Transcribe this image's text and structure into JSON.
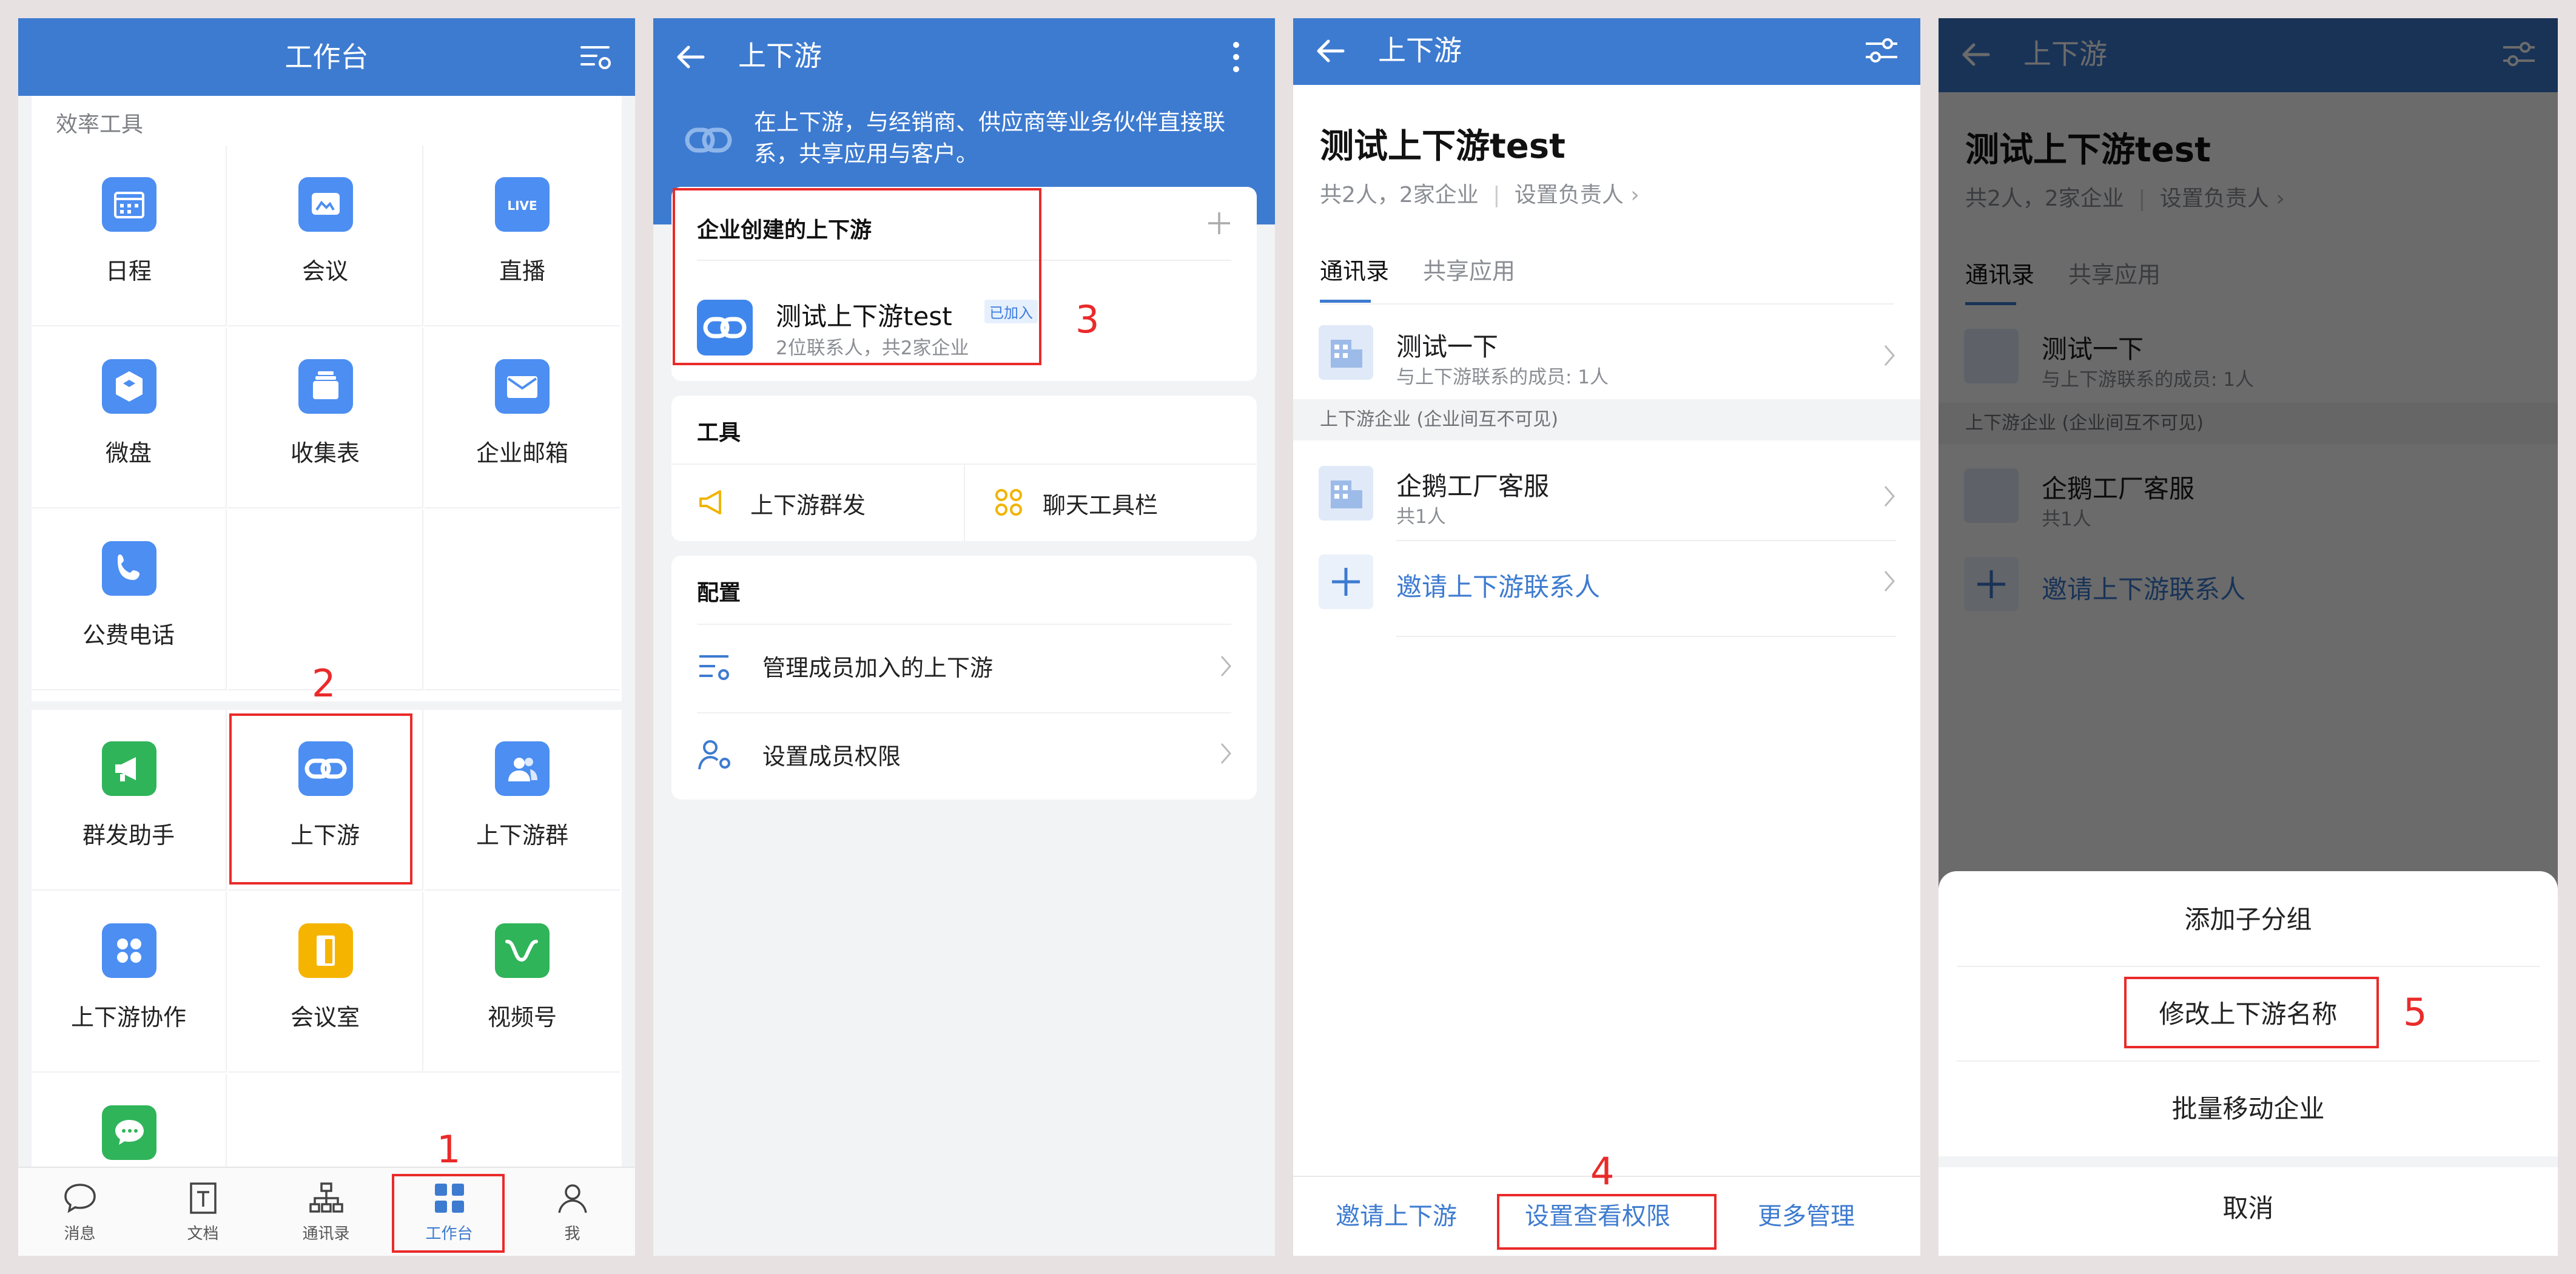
{
  "colors": {
    "brand_blue": "#3d7bd0",
    "annotation_red": "#ea2a2a"
  },
  "p1": {
    "title": "工作台",
    "section_label": "效率工具",
    "apps_top": [
      {
        "label": "日程",
        "icon": "calendar-icon",
        "color": "#4c8ef2"
      },
      {
        "label": "会议",
        "icon": "meeting-icon",
        "color": "#4c8ef2"
      },
      {
        "label": "直播",
        "icon": "live-icon",
        "color": "#4c8ef2",
        "badge": "LIVE"
      },
      {
        "label": "微盘",
        "icon": "drive-icon",
        "color": "#4c8ef2"
      },
      {
        "label": "收集表",
        "icon": "form-icon",
        "color": "#4c8ef2"
      },
      {
        "label": "企业邮箱",
        "icon": "mail-icon",
        "color": "#4c8ef2"
      },
      {
        "label": "公费电话",
        "icon": "phone-icon",
        "color": "#4c8ef2"
      }
    ],
    "apps_bottom": [
      {
        "label": "群发助手",
        "icon": "megaphone-icon",
        "color": "#2fb45a"
      },
      {
        "label": "上下游",
        "icon": "link-icon",
        "color": "#4c8ef2"
      },
      {
        "label": "上下游群",
        "icon": "group-icon",
        "color": "#4c8ef2"
      },
      {
        "label": "上下游协作",
        "icon": "collab-icon",
        "color": "#4c8ef2"
      },
      {
        "label": "会议室",
        "icon": "door-icon",
        "color": "#f5b400"
      },
      {
        "label": "视频号",
        "icon": "channels-icon",
        "color": "#2fb45a"
      }
    ],
    "tabs": [
      "消息",
      "文档",
      "通讯录",
      "工作台",
      "我"
    ],
    "annotations": [
      "1",
      "2"
    ]
  },
  "p2": {
    "title": "上下游",
    "banner": "在上下游，与经销商、供应商等业务伙伴直接联系，共享应用与客户。",
    "created_title": "企业创建的上下游",
    "item_name": "测试上下游test",
    "item_tag": "已加入",
    "item_sub": "2位联系人，共2家企业",
    "tools_title": "工具",
    "tool1": "上下游群发",
    "tool2": "聊天工具栏",
    "config_title": "配置",
    "config1": "管理成员加入的上下游",
    "config2": "设置成员权限",
    "annotation": "3"
  },
  "p3": {
    "title": "上下游",
    "name": "测试上下游test",
    "meta_count": "共2人，2家企业",
    "meta_link": "设置负责人",
    "tab1": "通讯录",
    "tab2": "共享应用",
    "entry1_title": "测试一下",
    "entry1_sub": "与上下游联系的成员: 1人",
    "band": "上下游企业 (企业间互不可见)",
    "entry2_title": "企鹅工厂客服",
    "entry2_sub": "共1人",
    "invite": "邀请上下游联系人",
    "btn1": "邀请上下游",
    "btn2": "设置查看权限",
    "btn3": "更多管理",
    "annotation": "4"
  },
  "p4": {
    "sheet1": "添加子分组",
    "sheet2": "修改上下游名称",
    "sheet3": "批量移动企业",
    "cancel": "取消",
    "annotation": "5"
  }
}
